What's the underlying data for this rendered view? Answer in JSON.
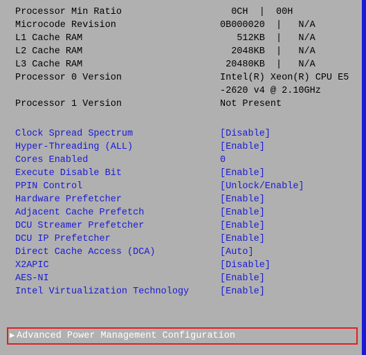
{
  "info": [
    {
      "label": "Processor Min Ratio",
      "value": "  0CH  |  00H"
    },
    {
      "label": "Microcode Revision",
      "value": "0B000020  |   N/A"
    },
    {
      "label": "L1 Cache RAM",
      "value": "   512KB  |   N/A"
    },
    {
      "label": "L2 Cache RAM",
      "value": "  2048KB  |   N/A"
    },
    {
      "label": "L3 Cache RAM",
      "value": " 20480KB  |   N/A"
    },
    {
      "label": "Processor 0 Version",
      "value": "Intel(R) Xeon(R) CPU E5"
    },
    {
      "label": "",
      "value": "-2620 v4 @ 2.10GHz"
    },
    {
      "label": "Processor 1 Version",
      "value": "Not Present"
    }
  ],
  "options": [
    {
      "label": "Clock Spread Spectrum",
      "value": "[Disable]"
    },
    {
      "label": "Hyper-Threading (ALL)",
      "value": "[Enable]"
    },
    {
      "label": "Cores Enabled",
      "value": "0"
    },
    {
      "label": "Execute Disable Bit",
      "value": "[Enable]"
    },
    {
      "label": "PPIN Control",
      "value": "[Unlock/Enable]"
    },
    {
      "label": "Hardware Prefetcher",
      "value": "[Enable]"
    },
    {
      "label": "Adjacent Cache Prefetch",
      "value": "[Enable]"
    },
    {
      "label": "DCU Streamer Prefetcher",
      "value": "[Enable]"
    },
    {
      "label": "DCU IP Prefetcher",
      "value": "[Enable]"
    },
    {
      "label": "Direct Cache Access (DCA)",
      "value": "[Auto]"
    },
    {
      "label": "X2APIC",
      "value": "[Disable]"
    },
    {
      "label": "AES-NI",
      "value": "[Enable]"
    },
    {
      "label": "Intel Virtualization Technology",
      "value": "[Enable]"
    }
  ],
  "submenu": {
    "caret": "▶",
    "label": "Advanced Power Management Configuration"
  }
}
